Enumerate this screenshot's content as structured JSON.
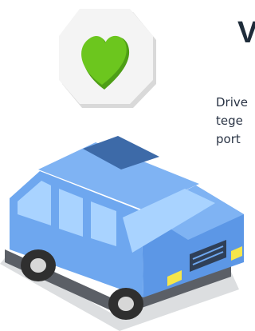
{
  "heading": {
    "fragment": "V"
  },
  "body": {
    "lines": [
      "Drive",
      "tege",
      "port"
    ]
  },
  "illustration": {
    "badge_icon": "heart-icon",
    "vehicle": "van",
    "colors": {
      "heart": "#6cc61e",
      "van_body": "#6ea7ef",
      "van_shadow": "#4d84d6",
      "windows": "#a9d3ff",
      "roof_panel": "#3d6aa8",
      "headlights": "#f6e64a",
      "tires": "#3a3a3a",
      "badge": "#f1f1f1"
    }
  }
}
